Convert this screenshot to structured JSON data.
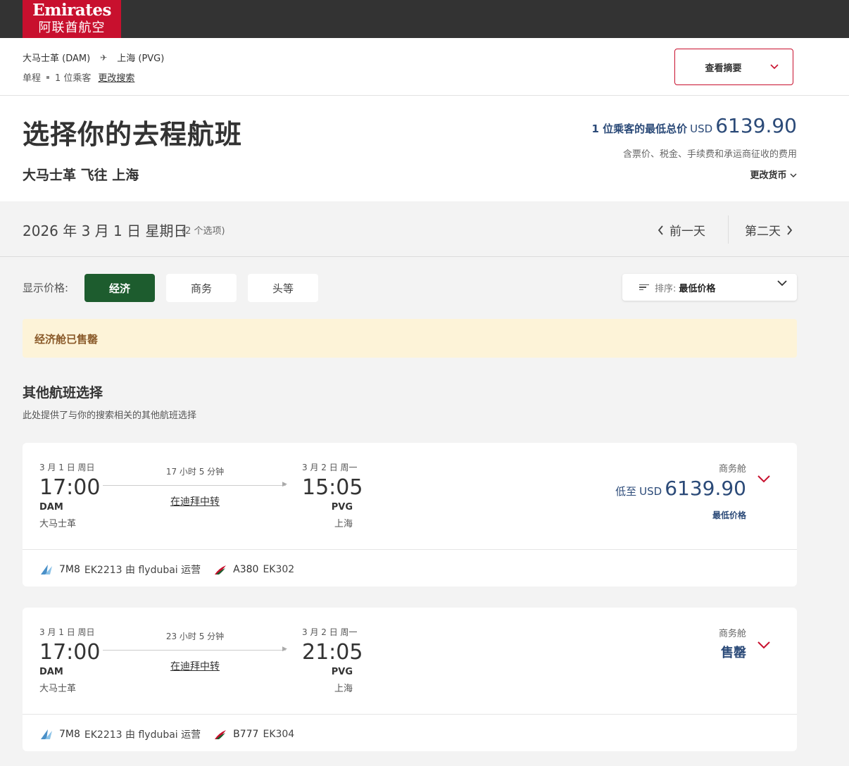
{
  "brand": {
    "name_en": "Emirates",
    "name_cn": "阿联酋航空",
    "color": "#c8102e"
  },
  "trip": {
    "origin": "大马士革 (DAM)",
    "destination": "上海 (PVG)",
    "type": "单程",
    "passengers": "1 位乘客",
    "modify_link": "更改搜索",
    "summary_button": "查看摘要"
  },
  "header": {
    "title": "选择你的去程航班",
    "subtitle": "大马士革 飞往 上海",
    "lowest_label": "1 位乘客的最低总价",
    "lowest_currency": "USD",
    "lowest_amount": "6139.90",
    "taxes_note": "含票价、税金、手续费和承运商征收的费用",
    "currency_link": "更改货币"
  },
  "datebar": {
    "date": "2026 年 3 月 1 日 星期日",
    "options": "(2 个选项)",
    "prev": "前一天",
    "next": "第二天"
  },
  "filters": {
    "label": "显示价格:",
    "cabins": [
      "经济",
      "商务",
      "头等"
    ],
    "active_cabin": "经济",
    "active_color": "#1d5c2e",
    "sort_label": "排序:",
    "sort_value": "最低价格"
  },
  "banner": {
    "text": "经济舱已售罄"
  },
  "other": {
    "title": "其他航班选择",
    "desc": "此处提供了与你的搜索相关的其他航班选择"
  },
  "flights": [
    {
      "dep_date": "3 月 1 日 周日",
      "dep_time": "17:00",
      "dep_code": "DAM",
      "dep_city": "大马士革",
      "duration": "17 小时 5 分钟",
      "stop": "在迪拜中转",
      "arr_date": "3 月 2 日 周一",
      "arr_time": "15:05",
      "arr_code": "PVG",
      "arr_city": "上海",
      "cabin": "商务舱",
      "price_prefix": "低至",
      "price_currency": "USD",
      "price_amount": "6139.90",
      "price_badge": "最低价格",
      "seg1_aircraft": "7M8",
      "seg1_flight": "EK2213 由 flydubai 运营",
      "seg2_aircraft": "A380",
      "seg2_flight": "EK302"
    },
    {
      "dep_date": "3 月 1 日 周日",
      "dep_time": "17:00",
      "dep_code": "DAM",
      "dep_city": "大马士革",
      "duration": "23 小时 5 分钟",
      "stop": "在迪拜中转",
      "arr_date": "3 月 2 日 周一",
      "arr_time": "21:05",
      "arr_code": "PVG",
      "arr_city": "上海",
      "cabin": "商务舱",
      "status": "售罄",
      "seg1_aircraft": "7M8",
      "seg1_flight": "EK2213 由 flydubai 运营",
      "seg2_aircraft": "B777",
      "seg2_flight": "EK304"
    }
  ],
  "icons": {
    "plane": "plane-icon",
    "chevron_down": "chevron-down-icon",
    "chevron_left": "chevron-left-icon",
    "chevron_right": "chevron-right-icon",
    "sort": "sort-icon",
    "flydubai": "flydubai-logo-icon",
    "emirates": "emirates-logo-icon"
  }
}
